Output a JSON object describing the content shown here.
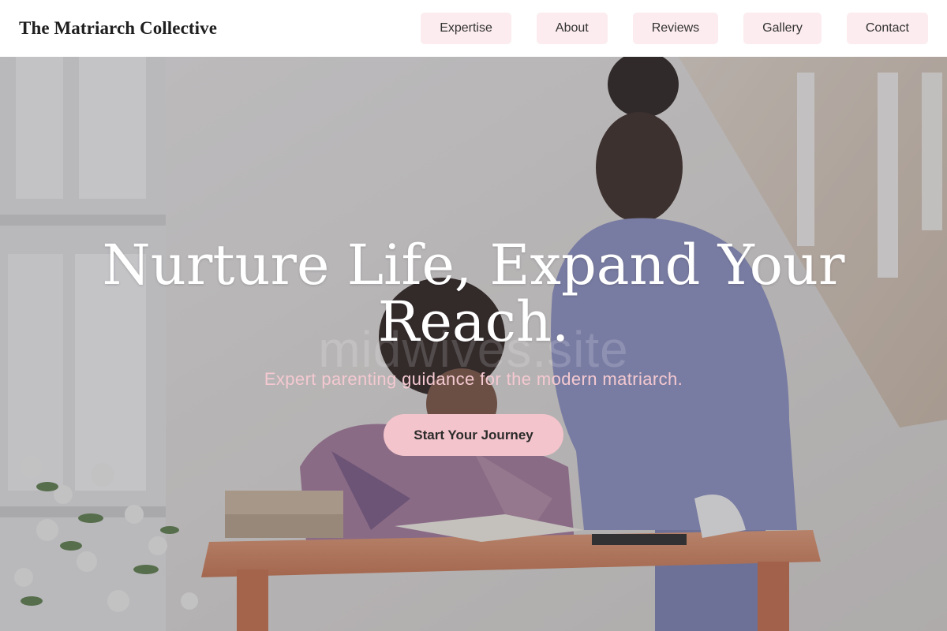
{
  "header": {
    "brand": "The Matriarch Collective",
    "nav": [
      {
        "label": "Expertise"
      },
      {
        "label": "About"
      },
      {
        "label": "Reviews"
      },
      {
        "label": "Gallery"
      },
      {
        "label": "Contact"
      }
    ]
  },
  "hero": {
    "title": "Nurture Life, Expand Your Reach.",
    "watermark": "midwives.site",
    "subtitle": "Expert parenting guidance for the modern matriarch.",
    "cta_label": "Start Your Journey"
  },
  "colors": {
    "nav_background": "#fcecef",
    "cta_background": "#f3c4cb",
    "subtitle": "#f4c9d1",
    "brand_text": "#1f1f1f"
  }
}
